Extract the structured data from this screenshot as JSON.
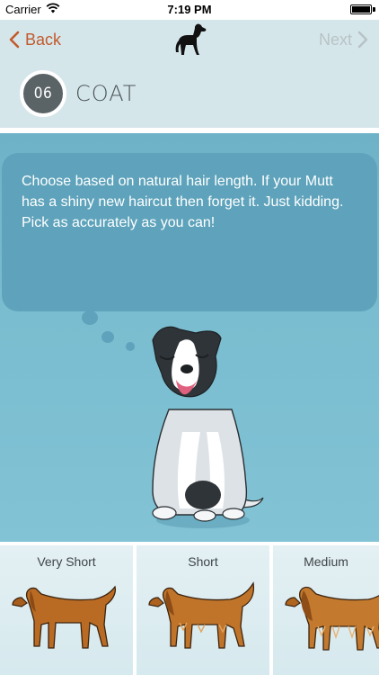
{
  "status_bar": {
    "carrier": "Carrier",
    "time": "7:19 PM"
  },
  "nav": {
    "back_label": "Back",
    "next_label": "Next",
    "accent_color": "#c25a2c",
    "disabled_color": "#b8c3c6"
  },
  "step": {
    "number": "06",
    "title": "COAT"
  },
  "bubble": {
    "text": "Choose based on natural hair length. If your Mutt has a shiny new haircut then forget it. Just kidding. Pick as accurately as you can!"
  },
  "options": [
    {
      "label": "Very Short"
    },
    {
      "label": "Short"
    },
    {
      "label": "Medium"
    }
  ],
  "icons": {
    "back": "chevron-left-icon",
    "next": "chevron-right-icon",
    "wifi": "wifi-icon",
    "battery": "battery-icon",
    "logo": "dog-logo-icon"
  }
}
